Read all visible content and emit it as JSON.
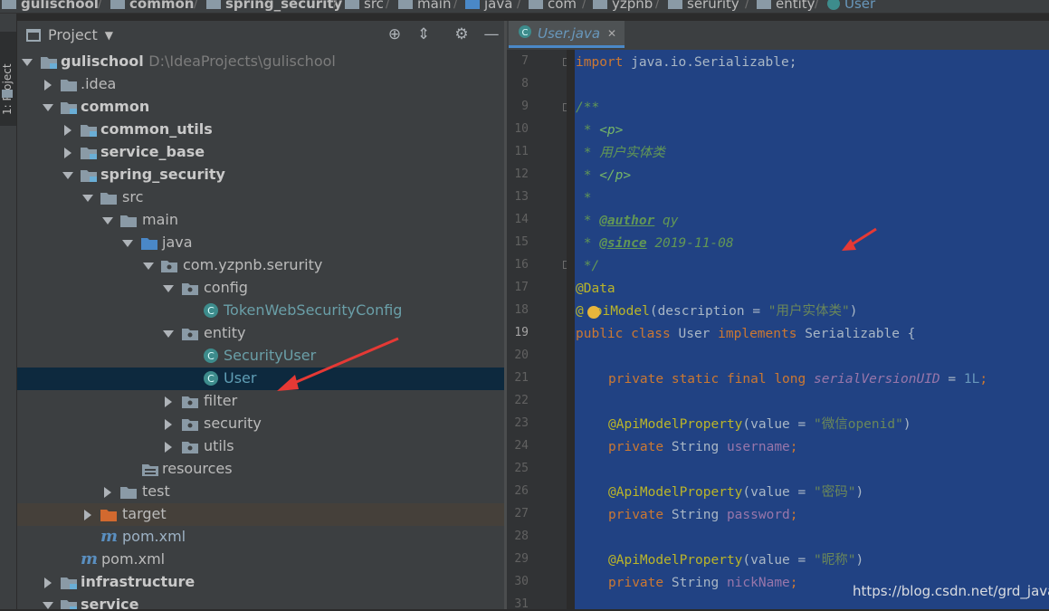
{
  "breadcrumb": [
    "gulischool",
    "common",
    "spring_security",
    "src",
    "main",
    "java",
    "com",
    "yzpnb",
    "serurity",
    "entity",
    "User"
  ],
  "side_strip": {
    "project_label": "1: Project"
  },
  "project_panel": {
    "title": "Project",
    "icons": [
      "globe-icon",
      "collapse-icon",
      "gear-icon",
      "minimize-icon"
    ]
  },
  "tree": [
    {
      "label": "gulischool",
      "hint": "D:\\IdeaProjects\\gulischool"
    },
    {
      "label": ".idea"
    },
    {
      "label": "common"
    },
    {
      "label": "common_utils"
    },
    {
      "label": "service_base"
    },
    {
      "label": "spring_security"
    },
    {
      "label": "src"
    },
    {
      "label": "main"
    },
    {
      "label": "java"
    },
    {
      "label": "com.yzpnb.serurity"
    },
    {
      "label": "config"
    },
    {
      "label": "TokenWebSecurityConfig"
    },
    {
      "label": "entity"
    },
    {
      "label": "SecurityUser"
    },
    {
      "label": "User"
    },
    {
      "label": "filter"
    },
    {
      "label": "security"
    },
    {
      "label": "utils"
    },
    {
      "label": "resources"
    },
    {
      "label": "test"
    },
    {
      "label": "target"
    },
    {
      "label": "pom.xml"
    },
    {
      "label": "pom.xml"
    },
    {
      "label": "infrastructure"
    },
    {
      "label": "service"
    }
  ],
  "editor": {
    "tab_label": "User.java",
    "line_numbers": [
      "7",
      "8",
      "9",
      "10",
      "11",
      "12",
      "13",
      "14",
      "15",
      "16",
      "17",
      "18",
      "19",
      "20",
      "21",
      "22",
      "23",
      "24",
      "25",
      "26",
      "27",
      "28",
      "29",
      "30",
      "31"
    ],
    "current_line": "19",
    "code": {
      "l7_kw": "import",
      "l7_rest": " java.io.Serializable;",
      "l9": "/**",
      "l10_a": " * ",
      "l10_b": "<p>",
      "l11": " * 用户实体类",
      "l12_a": " * ",
      "l12_b": "</p>",
      "l13": " *",
      "l14_a": " * ",
      "l14_tag": "@author",
      "l14_val": " qy",
      "l15_a": " * ",
      "l15_tag": "@since",
      "l15_val": " 2019-11-08",
      "l16": " */",
      "l17": "@Data",
      "l18_a": "@",
      "l18_b": "piModel",
      "l18_c": "(description = ",
      "l18_str": "\"用户实体类\"",
      "l18_d": ")",
      "l19_kw": "public class",
      "l19_mid": " User ",
      "l19_kw2": "implements",
      "l19_rest": " Serializable {",
      "l21_kw": "private static final long",
      "l21_field": "serialVersionUID",
      "l21_eq": " = ",
      "l21_num": "1L",
      "l21_end": ";",
      "l23_an": "@ApiModelProperty",
      "l23_a": "(value = ",
      "l23_str": "\"微信openid\"",
      "l23_b": ")",
      "l24_kw": "private",
      "l24_type": " String ",
      "l24_field": "username",
      "l24_end": ";",
      "l26_an": "@ApiModelProperty",
      "l26_a": "(value = ",
      "l26_str": "\"密码\"",
      "l26_b": ")",
      "l27_kw": "private",
      "l27_type": " String ",
      "l27_field": "password",
      "l27_end": ";",
      "l29_an": "@ApiModelProperty",
      "l29_a": "(value = ",
      "l29_str": "\"昵称\"",
      "l29_b": ")",
      "l30_kw": "private",
      "l30_type": " String ",
      "l30_field": "nickName",
      "l30_end": ";"
    }
  },
  "watermark": "https://blog.csdn.net/grd_java",
  "colors": {
    "selection": "#214283",
    "tree_selection": "#0d293e",
    "arrow_annotation": "#e53935"
  }
}
